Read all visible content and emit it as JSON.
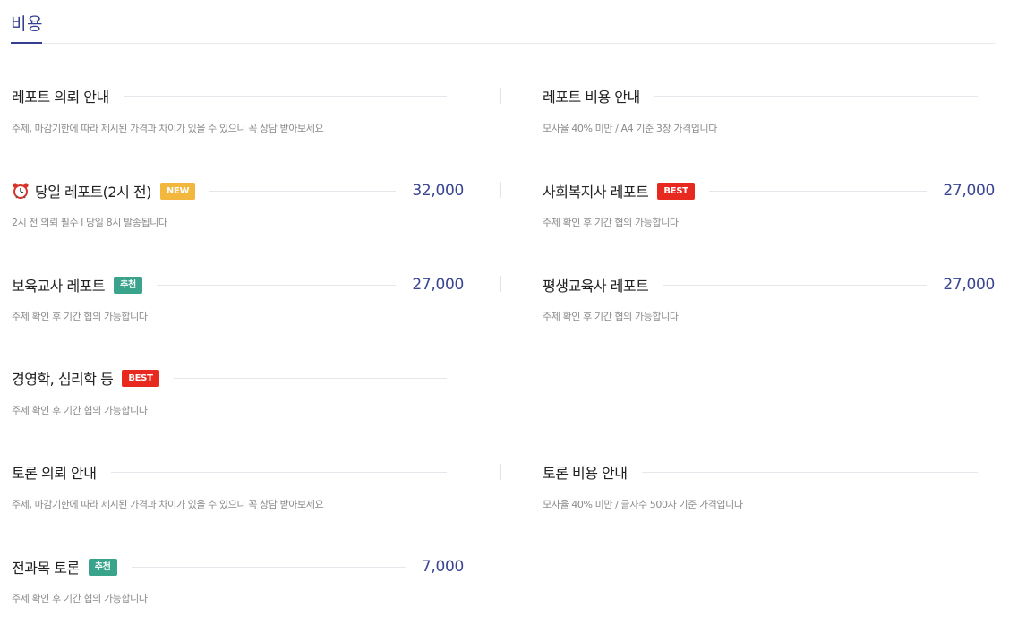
{
  "section": {
    "title": "비용"
  },
  "report_guide": {
    "title": "레포트 의뢰 안내",
    "desc": "주제, 마감기한에 따라 제시된 가격과 차이가 있을 수 있으니 꼭 상담 받아보세요"
  },
  "report_cost": {
    "title": "레포트 비용 안내",
    "desc": "모사율 40% 미만 / A4 기준 3장 가격입니다"
  },
  "items": [
    {
      "title": "당일 레포트(2시 전)",
      "icon": "alarm-clock-icon",
      "badge": "NEW",
      "price": "32,000",
      "desc": "2시 전 의뢰 필수 l 당일 8시 발송됩니다"
    },
    {
      "title": "사회복지사 레포트",
      "badge": "BEST",
      "price": "27,000",
      "desc": "주제 확인 후 기간 협의 가능합니다"
    },
    {
      "title": "보육교사 레포트",
      "badge": "추천",
      "price": "27,000",
      "desc": "주제 확인 후 기간 협의 가능합니다"
    },
    {
      "title": "평생교육사 레포트",
      "price": "27,000",
      "desc": "주제 확인 후 기간 협의 가능합니다"
    },
    {
      "title": "경영학, 심리학 등",
      "badge": "BEST",
      "desc": "주제 확인 후 기간 협의 가능합니다"
    }
  ],
  "debate_guide": {
    "title": "토론 의뢰 안내",
    "desc": "주제, 마감기한에 따라 제시된 가격과 차이가 있을 수 있으니 꼭 상담 받아보세요"
  },
  "debate_cost": {
    "title": "토론 비용 안내",
    "desc": "모사율 40% 미만 / 글자수 500자 기준 가격입니다"
  },
  "debate_item": {
    "title": "전과목 토론",
    "badge": "추천",
    "price": "7,000",
    "desc": "주제 확인 후 기간 협의 가능합니다"
  },
  "colors": {
    "accent": "#34408f",
    "new": "#f2b73c",
    "best": "#e8291f",
    "recommend": "#3aa38c"
  }
}
